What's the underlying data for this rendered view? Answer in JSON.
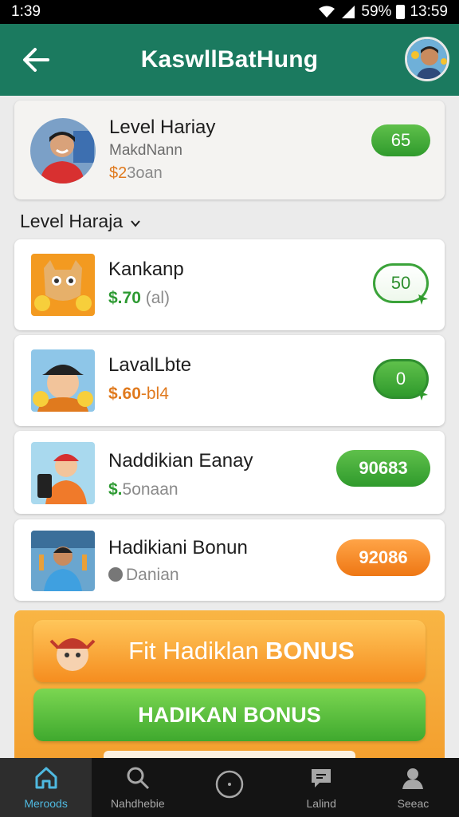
{
  "status": {
    "time": "1:39",
    "battery": "59%",
    "clock": "13:59"
  },
  "header": {
    "title": "KaswllBatHung"
  },
  "profile": {
    "name": "Level Hariay",
    "sub": "MakdNann",
    "money_value": "$2",
    "money_rest": "3oan",
    "badge": "65"
  },
  "section": {
    "title": "Level Haraja"
  },
  "rows": [
    {
      "name": "Kankanp",
      "sub_value": "$.70",
      "sub_rest": " (al)",
      "action": "50"
    },
    {
      "name": "LavalLbte",
      "sub_value": "$.60",
      "sub_rest": "-bl4",
      "action": "0"
    },
    {
      "name": "Naddikian Eanay",
      "sub_value": "$.",
      "sub_rest": "5onaan",
      "action": "90683"
    },
    {
      "name": "Hadikiani Bonun",
      "sub_value": "",
      "sub_rest": "Danian",
      "action": "92086"
    }
  ],
  "bonus": {
    "primary_prefix": "Fit Hadiklan",
    "primary_bold": "BONUS",
    "secondary": "HADIKAN BONUS"
  },
  "nav": [
    {
      "label": "Meroods",
      "icon": "home-icon"
    },
    {
      "label": "Nahdhebie",
      "icon": "search-icon"
    },
    {
      "label": "",
      "icon": "circle-icon"
    },
    {
      "label": "Lalind",
      "icon": "chat-icon"
    },
    {
      "label": "Seeac",
      "icon": "profile-icon"
    }
  ],
  "colors": {
    "app_bar": "#1b7a5f",
    "accent_green": "#3ba33a",
    "accent_orange": "#f58d1f",
    "nav_active": "#4fb9e0"
  }
}
